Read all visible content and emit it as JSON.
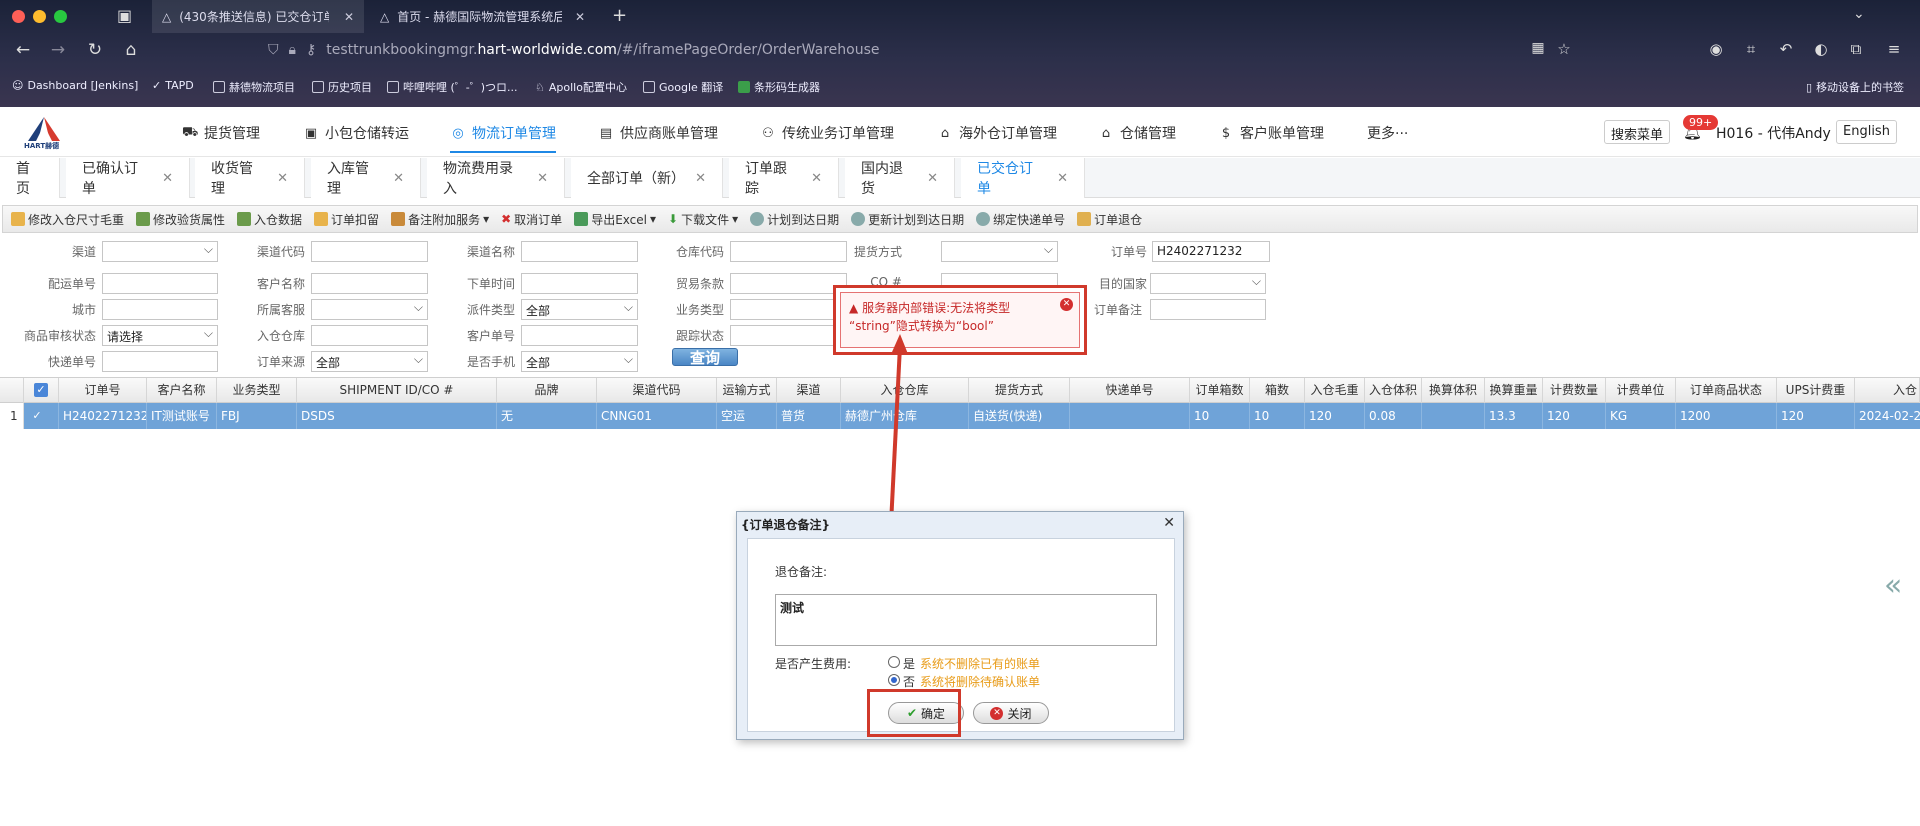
{
  "browser": {
    "tabs": [
      {
        "title": "(430条推送信息) 已交仓订单 - "
      },
      {
        "title": "首页 - 赫德国际物流管理系统后台"
      }
    ],
    "url_prefix": "testtrunkbookingmgr.",
    "url_domain": "hart-worldwide.com",
    "url_path": "/#/iframePageOrder/OrderWarehouse",
    "bookmarks": [
      "Dashboard [Jenkins]",
      "TAPD",
      "赫德物流项目",
      "历史项目",
      "哔哩哔哩 (゜-゜)つロ...",
      "Apollo配置中心",
      "Google 翻译",
      "条形码生成器"
    ],
    "mobile_bookmarks": "移动设备上的书签"
  },
  "app": {
    "logo_text": "HART赫德",
    "menus": [
      "提货管理",
      "小包仓储转运",
      "物流订单管理",
      "供应商账单管理",
      "传统业务订单管理",
      "海外仓订单管理",
      "仓储管理",
      "客户账单管理",
      "更多···"
    ],
    "search_menu": "搜索菜单",
    "badge": "99+",
    "user": "H016 - 代伟Andy",
    "language": "English"
  },
  "page_tabs": [
    "首页",
    "已确认订单",
    "收货管理",
    "入库管理",
    "物流费用录入",
    "全部订单（新）",
    "订单跟踪",
    "国内退货",
    "已交仓订单"
  ],
  "toolbar": [
    "修改入仓尺寸毛重",
    "修改验货属性",
    "入仓数据",
    "订单扣留",
    "备注附加服务",
    "取消订单",
    "导出Excel",
    "下载文件",
    "计划到达日期",
    "更新计划到达日期",
    "绑定快递单号",
    "订单退仓"
  ],
  "filters": {
    "labels": [
      "渠道",
      "渠道代码",
      "渠道名称",
      "仓库代码",
      "提货方式",
      "订单号",
      "配运单号",
      "客户名称",
      "下单时间",
      "贸易条款",
      "CO #",
      "目的国家",
      "城市",
      "所属客服",
      "派件类型",
      "业务类型",
      "订单备注",
      "商品审核状态",
      "入仓仓库",
      "客户单号",
      "跟踪状态",
      "快递单号",
      "订单来源",
      "是否手机"
    ],
    "order_no": "H2402271232",
    "dispatch_type": "全部",
    "review_status": "请选择",
    "order_source": "全部",
    "is_mobile": "全部",
    "query_button": "查询"
  },
  "grid": {
    "headers": [
      "订单号",
      "客户名称",
      "业务类型",
      "SHIPMENT ID/CO #",
      "品牌",
      "渠道代码",
      "运输方式",
      "渠道",
      "入仓仓库",
      "提货方式",
      "快递单号",
      "订单箱数",
      "箱数",
      "入仓毛重",
      "入仓体积",
      "换算体积",
      "换算重量",
      "计费数量",
      "计费单位",
      "订单商品状态",
      "UPS计费重",
      "入仓"
    ],
    "row_num": "1",
    "row": [
      "H2402271232",
      "IT测试账号",
      "FBJ",
      "DSDS",
      "无",
      "CNNG01",
      "空运",
      "普货",
      "赫德广州仓库",
      "自送货(快递)",
      "",
      "10",
      "10",
      "120",
      "0.08",
      "",
      "13.3",
      "120",
      "KG",
      "1200",
      "120",
      "2024-02-2"
    ]
  },
  "error": {
    "line1": "服务器内部错误:无法将类型",
    "line2": "“string”隐式转换为“bool”"
  },
  "dialog": {
    "title": "{订单退仓备注}",
    "remark_label": "退仓备注:",
    "remark_value": "测试",
    "fee_label": "是否产生费用:",
    "opt_yes": "是",
    "opt_yes_note": "系统不删除已有的账单",
    "opt_no": "否",
    "opt_no_note": "系统将删除待确认账单",
    "confirm": "确定",
    "close": "关闭"
  },
  "colors": {
    "accent": "#1e88e5",
    "selected_row": "#6fa3d8",
    "error_red": "#d0392b",
    "warn_orange": "#e89b17"
  }
}
